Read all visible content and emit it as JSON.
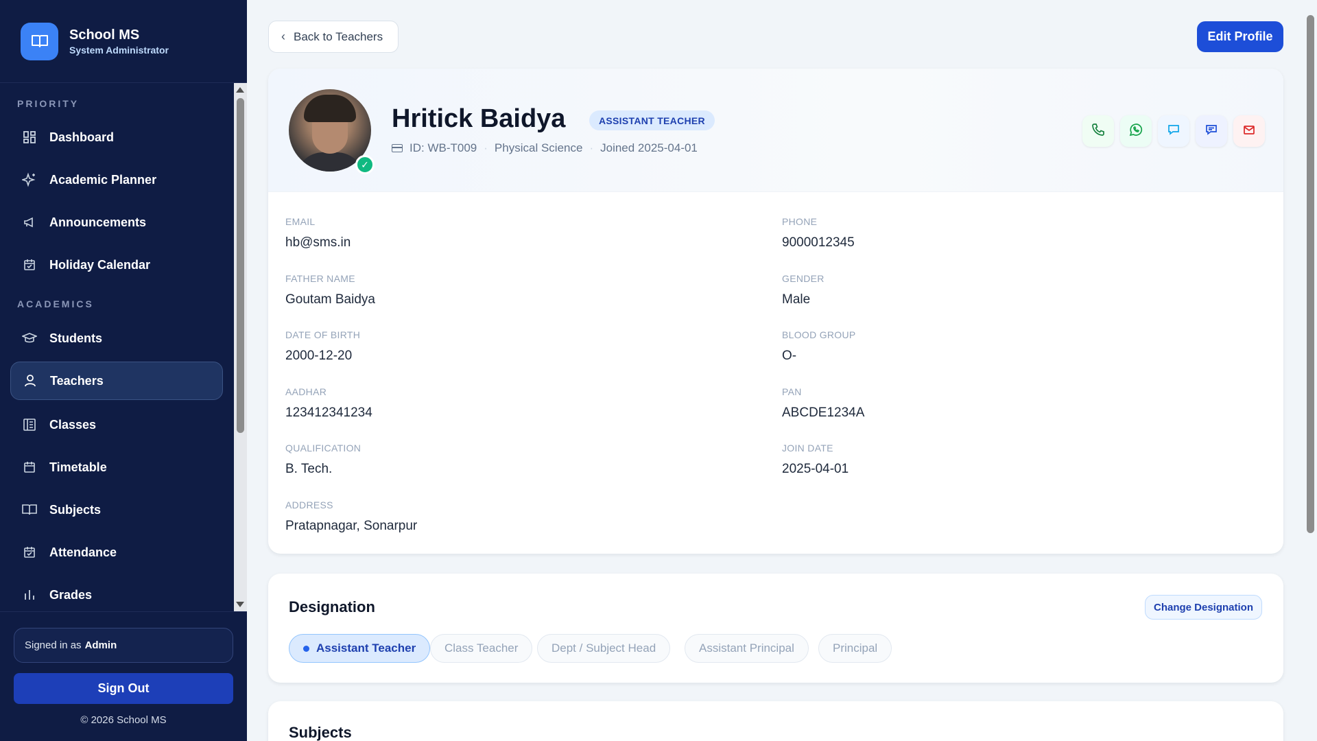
{
  "brand": {
    "title": "School MS",
    "subtitle": "System Administrator"
  },
  "nav": {
    "sections": [
      "PRIORITY",
      "ACADEMICS"
    ],
    "items": [
      {
        "label": "Dashboard",
        "icon": "dashboard-icon"
      },
      {
        "label": "Academic Planner",
        "icon": "sparkles-icon"
      },
      {
        "label": "Announcements",
        "icon": "megaphone-icon"
      },
      {
        "label": "Holiday Calendar",
        "icon": "calendar-check-icon"
      },
      {
        "label": "Students",
        "icon": "graduation-cap-icon"
      },
      {
        "label": "Teachers",
        "icon": "user-icon",
        "active": true
      },
      {
        "label": "Classes",
        "icon": "columns-icon"
      },
      {
        "label": "Timetable",
        "icon": "calendar-icon"
      },
      {
        "label": "Subjects",
        "icon": "book-icon"
      },
      {
        "label": "Attendance",
        "icon": "calendar-check-icon"
      },
      {
        "label": "Grades",
        "icon": "bar-chart-icon"
      }
    ]
  },
  "footer": {
    "signed_in_prefix": "Signed in as",
    "signed_in_user": "Admin",
    "sign_out": "Sign Out",
    "copyright": "© 2026 School MS"
  },
  "header": {
    "back_label": "Back to Teachers",
    "edit_label": "Edit Profile"
  },
  "profile": {
    "name": "Hritick Baidya",
    "role_badge": "ASSISTANT TEACHER",
    "id": "ID: WB-T009",
    "department": "Physical Science",
    "joined": "Joined 2025-04-01",
    "contact_actions": [
      "phone-icon",
      "whatsapp-icon",
      "sms-icon",
      "message-icon",
      "email-icon"
    ],
    "fields": [
      {
        "label": "EMAIL",
        "value": "hb@sms.in"
      },
      {
        "label": "PHONE",
        "value": "9000012345"
      },
      {
        "label": "FATHER NAME",
        "value": "Goutam Baidya"
      },
      {
        "label": "GENDER",
        "value": "Male"
      },
      {
        "label": "DATE OF BIRTH",
        "value": "2000-12-20"
      },
      {
        "label": "BLOOD GROUP",
        "value": "O-"
      },
      {
        "label": "AADHAR",
        "value": "123412341234"
      },
      {
        "label": "PAN",
        "value": "ABCDE1234A"
      },
      {
        "label": "QUALIFICATION",
        "value": "B. Tech."
      },
      {
        "label": "JOIN DATE",
        "value": "2025-04-01"
      },
      {
        "label": "ADDRESS",
        "value": "Pratapnagar, Sonarpur"
      }
    ]
  },
  "designation": {
    "title": "Designation",
    "change_label": "Change Designation",
    "options": [
      "Assistant Teacher",
      "Class Teacher",
      "Dept / Subject Head",
      "Assistant Principal",
      "Principal"
    ],
    "selected": "Assistant Teacher"
  },
  "subjects": {
    "title": "Subjects"
  },
  "colors": {
    "sidebar": "#0f1c44",
    "accent": "#1d4ed8",
    "verified": "#10b981"
  }
}
